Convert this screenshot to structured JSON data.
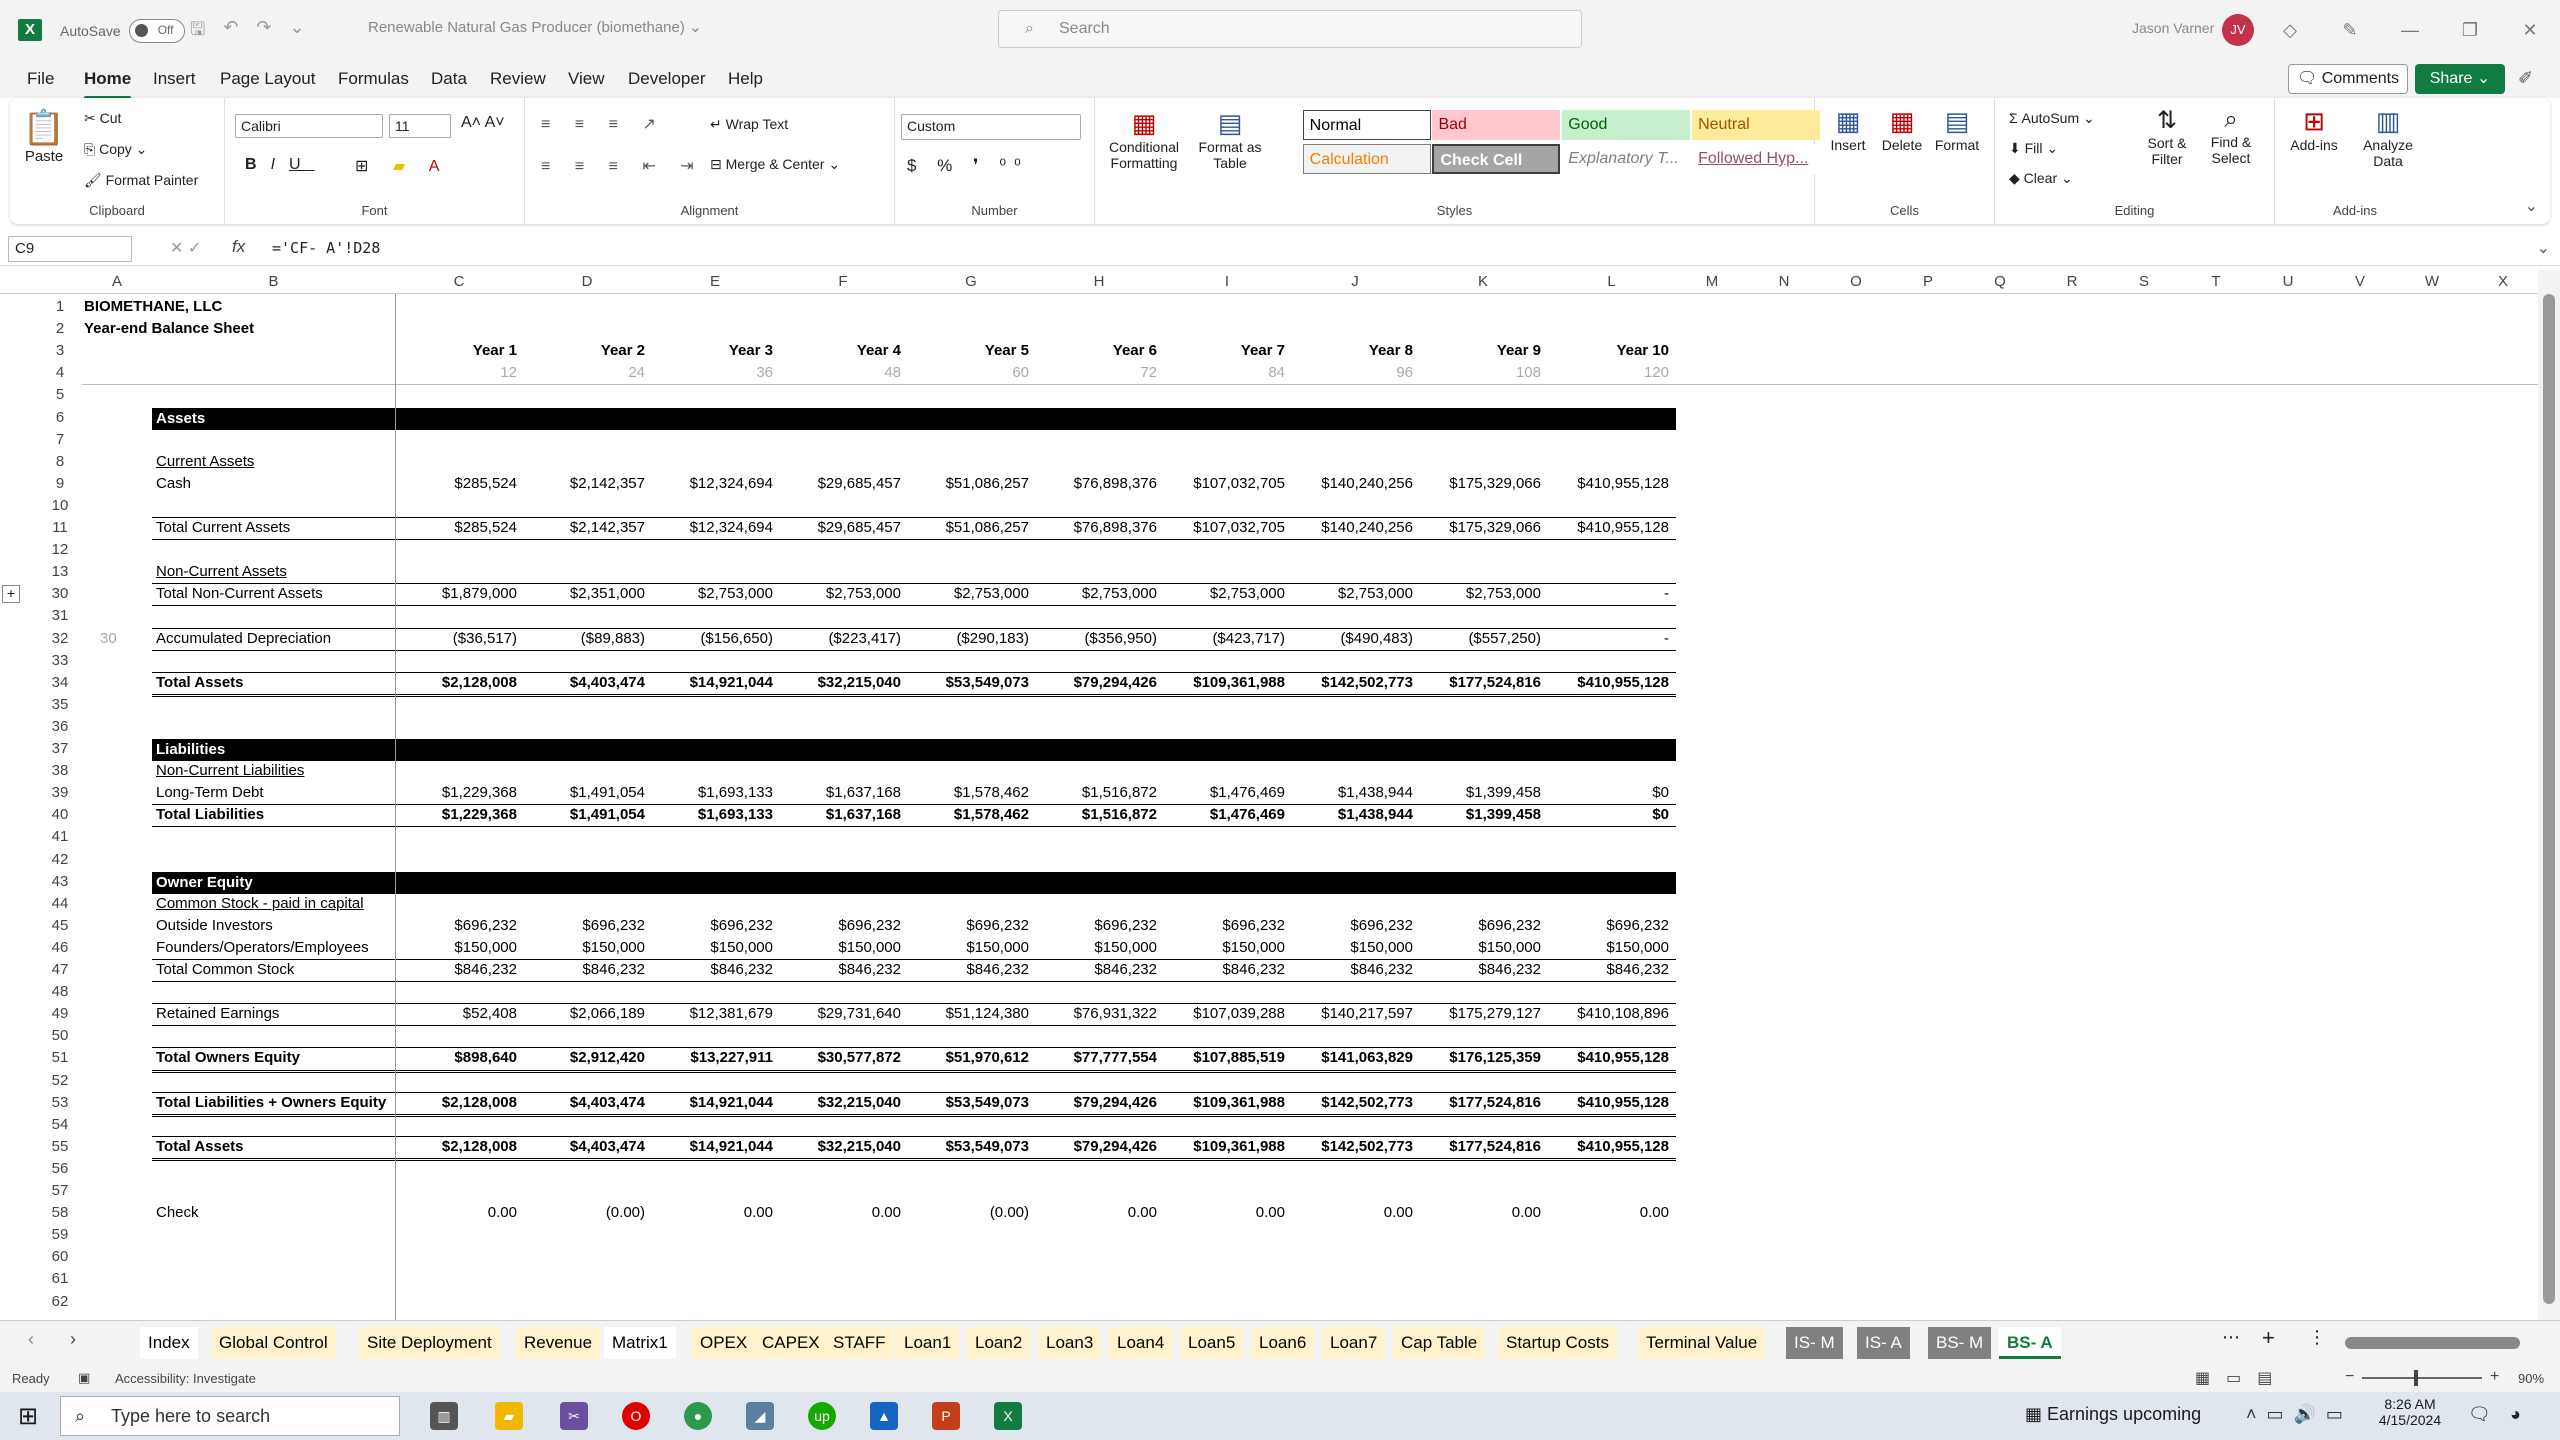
{
  "app": {
    "autosave_label": "AutoSave",
    "autosave_state": "Off",
    "doc_title": "Renewable Natural Gas Producer (biomethane)",
    "search_placeholder": "Search",
    "user_name": "Jason Varner",
    "user_initials": "JV"
  },
  "menu": [
    "File",
    "Home",
    "Insert",
    "Page Layout",
    "Formulas",
    "Data",
    "Review",
    "View",
    "Developer",
    "Help"
  ],
  "menu_active": "Home",
  "actions": {
    "comments": "Comments",
    "share": "Share"
  },
  "ribbon": {
    "clipboard": {
      "label": "Clipboard",
      "paste": "Paste",
      "cut": "Cut",
      "copy": "Copy",
      "format_painter": "Format Painter"
    },
    "font": {
      "label": "Font",
      "name": "Calibri",
      "size": "11"
    },
    "alignment": {
      "label": "Alignment",
      "wrap": "Wrap Text",
      "merge": "Merge & Center"
    },
    "number": {
      "label": "Number",
      "format": "Custom"
    },
    "styles": {
      "label": "Styles",
      "conditional": "Conditional Formatting",
      "format_table": "Format as Table",
      "cells": [
        {
          "text": "Normal",
          "bg": "#ffffff",
          "fg": "#000000"
        },
        {
          "text": "Bad",
          "bg": "#ffc7ce",
          "fg": "#9c0006"
        },
        {
          "text": "Good",
          "bg": "#c6efce",
          "fg": "#006100"
        },
        {
          "text": "Neutral",
          "bg": "#ffeb9c",
          "fg": "#9c5700"
        },
        {
          "text": "Calculation",
          "bg": "#f2f2f2",
          "fg": "#fa7d00"
        },
        {
          "text": "Check Cell",
          "bg": "#a5a5a5",
          "fg": "#ffffff"
        },
        {
          "text": "Explanatory T...",
          "bg": "#ffffff",
          "fg": "#7f7f7f"
        },
        {
          "text": "Followed Hyp...",
          "bg": "#ffffff",
          "fg": "#954f72"
        }
      ]
    },
    "cells": {
      "label": "Cells",
      "insert": "Insert",
      "delete": "Delete",
      "format": "Format"
    },
    "editing": {
      "label": "Editing",
      "autosum": "AutoSum",
      "fill": "Fill",
      "clear": "Clear",
      "sort": "Sort & Filter",
      "find": "Find & Select"
    },
    "addins": {
      "label": "Add-ins",
      "addins": "Add-ins",
      "analyze": "Analyze Data"
    }
  },
  "formula_bar": {
    "cell_ref": "C9",
    "formula": "='CF- A'!D28"
  },
  "columns": [
    "A",
    "B",
    "C",
    "D",
    "E",
    "F",
    "G",
    "H",
    "I",
    "J",
    "K",
    "L",
    "M",
    "N",
    "O",
    "P",
    "Q",
    "R",
    "S",
    "T",
    "U",
    "V",
    "W",
    "X"
  ],
  "sheet": {
    "company": "BIOMETHANE, LLC",
    "title": "Year-end Balance Sheet",
    "years": [
      "Year 1",
      "Year 2",
      "Year 3",
      "Year 4",
      "Year 5",
      "Year 6",
      "Year 7",
      "Year 8",
      "Year 9",
      "Year 10"
    ],
    "months": [
      "12",
      "24",
      "36",
      "48",
      "60",
      "72",
      "84",
      "96",
      "108",
      "120"
    ],
    "a32": "30",
    "rows": [
      {
        "r": "6",
        "section": "Assets"
      },
      {
        "r": "8",
        "label": "Current Assets",
        "ul": true
      },
      {
        "r": "9",
        "label": " Cash",
        "vals": [
          "$285,524",
          "$2,142,357",
          "$12,324,694",
          "$29,685,457",
          "$51,086,257",
          "$76,898,376",
          "$107,032,705",
          "$140,240,256",
          "$175,329,066",
          "$410,955,128"
        ]
      },
      {
        "r": "11",
        "label": "Total Current Assets",
        "vals": [
          "$285,524",
          "$2,142,357",
          "$12,324,694",
          "$29,685,457",
          "$51,086,257",
          "$76,898,376",
          "$107,032,705",
          "$140,240,256",
          "$175,329,066",
          "$410,955,128"
        ]
      },
      {
        "r": "13",
        "label": "Non-Current Assets",
        "ul": true
      },
      {
        "r": "30",
        "label": "Total Non-Current Assets",
        "vals": [
          "$1,879,000",
          "$2,351,000",
          "$2,753,000",
          "$2,753,000",
          "$2,753,000",
          "$2,753,000",
          "$2,753,000",
          "$2,753,000",
          "$2,753,000",
          "-"
        ]
      },
      {
        "r": "32",
        "label": "Accumulated Depreciation",
        "vals": [
          "($36,517)",
          "($89,883)",
          "($156,650)",
          "($223,417)",
          "($290,183)",
          "($356,950)",
          "($423,717)",
          "($490,483)",
          "($557,250)",
          "-"
        ]
      },
      {
        "r": "34",
        "label": "Total Assets",
        "bold": true,
        "vals": [
          "$2,128,008",
          "$4,403,474",
          "$14,921,044",
          "$32,215,040",
          "$53,549,073",
          "$79,294,426",
          "$109,361,988",
          "$142,502,773",
          "$177,524,816",
          "$410,955,128"
        ]
      },
      {
        "r": "37",
        "section": "Liabilities"
      },
      {
        "r": "38",
        "label": "Non-Current Liabilities",
        "ul": true
      },
      {
        "r": "39",
        "label": "Long-Term Debt",
        "vals": [
          "$1,229,368",
          "$1,491,054",
          "$1,693,133",
          "$1,637,168",
          "$1,578,462",
          "$1,516,872",
          "$1,476,469",
          "$1,438,944",
          "$1,399,458",
          "$0"
        ]
      },
      {
        "r": "40",
        "label": "Total Liabilities",
        "bold": true,
        "vals": [
          "$1,229,368",
          "$1,491,054",
          "$1,693,133",
          "$1,637,168",
          "$1,578,462",
          "$1,516,872",
          "$1,476,469",
          "$1,438,944",
          "$1,399,458",
          "$0"
        ]
      },
      {
        "r": "43",
        "section": "Owner Equity"
      },
      {
        "r": "44",
        "label": "Common Stock - paid in capital",
        "ul": true
      },
      {
        "r": "45",
        "label": "Outside Investors",
        "vals": [
          "$696,232",
          "$696,232",
          "$696,232",
          "$696,232",
          "$696,232",
          "$696,232",
          "$696,232",
          "$696,232",
          "$696,232",
          "$696,232"
        ]
      },
      {
        "r": "46",
        "label": "Founders/Operators/Employees",
        "vals": [
          "$150,000",
          "$150,000",
          "$150,000",
          "$150,000",
          "$150,000",
          "$150,000",
          "$150,000",
          "$150,000",
          "$150,000",
          "$150,000"
        ]
      },
      {
        "r": "47",
        "label": "Total Common Stock",
        "vals": [
          "$846,232",
          "$846,232",
          "$846,232",
          "$846,232",
          "$846,232",
          "$846,232",
          "$846,232",
          "$846,232",
          "$846,232",
          "$846,232"
        ]
      },
      {
        "r": "49",
        "label": "Retained Earnings",
        "vals": [
          "$52,408",
          "$2,066,189",
          "$12,381,679",
          "$29,731,640",
          "$51,124,380",
          "$76,931,322",
          "$107,039,288",
          "$140,217,597",
          "$175,279,127",
          "$410,108,896"
        ]
      },
      {
        "r": "51",
        "label": "Total Owners Equity",
        "bold": true,
        "vals": [
          "$898,640",
          "$2,912,420",
          "$13,227,911",
          "$30,577,872",
          "$51,970,612",
          "$77,777,554",
          "$107,885,519",
          "$141,063,829",
          "$176,125,359",
          "$410,955,128"
        ]
      },
      {
        "r": "53",
        "label": "Total Liabilities + Owners Equity",
        "bold": true,
        "vals": [
          "$2,128,008",
          "$4,403,474",
          "$14,921,044",
          "$32,215,040",
          "$53,549,073",
          "$79,294,426",
          "$109,361,988",
          "$142,502,773",
          "$177,524,816",
          "$410,955,128"
        ]
      },
      {
        "r": "55",
        "label": "Total Assets",
        "bold": true,
        "vals": [
          "$2,128,008",
          "$4,403,474",
          "$14,921,044",
          "$32,215,040",
          "$53,549,073",
          "$79,294,426",
          "$109,361,988",
          "$142,502,773",
          "$177,524,816",
          "$410,955,128"
        ]
      },
      {
        "r": "58",
        "label": "Check",
        "vals": [
          "0.00",
          "(0.00)",
          "0.00",
          "0.00",
          "(0.00)",
          "0.00",
          "0.00",
          "0.00",
          "0.00",
          "0.00"
        ]
      }
    ],
    "row_numbers": [
      "1",
      "2",
      "3",
      "4",
      "5",
      "6",
      "7",
      "8",
      "9",
      "10",
      "11",
      "12",
      "13",
      "30",
      "31",
      "32",
      "33",
      "34",
      "35",
      "36",
      "37",
      "38",
      "39",
      "40",
      "41",
      "42",
      "43",
      "44",
      "45",
      "46",
      "47",
      "48",
      "49",
      "50",
      "51",
      "52",
      "53",
      "54",
      "55",
      "56",
      "57",
      "58",
      "59",
      "60",
      "61",
      "62"
    ]
  },
  "tabs": [
    {
      "name": "Index",
      "bg": "#ffffff",
      "fg": "#000"
    },
    {
      "name": "Global Control",
      "bg": "#fff2cc",
      "fg": "#000"
    },
    {
      "name": "Site Deployment",
      "bg": "#fff2cc",
      "fg": "#000"
    },
    {
      "name": "Revenue",
      "bg": "#fff2cc",
      "fg": "#000"
    },
    {
      "name": "Matrix1",
      "bg": "#ffffff",
      "fg": "#000"
    },
    {
      "name": "OPEX",
      "bg": "#fff2cc",
      "fg": "#000"
    },
    {
      "name": "CAPEX",
      "bg": "#fff2cc",
      "fg": "#000"
    },
    {
      "name": "STAFF",
      "bg": "#fff2cc",
      "fg": "#000"
    },
    {
      "name": "Loan1",
      "bg": "#fff2cc",
      "fg": "#000"
    },
    {
      "name": "Loan2",
      "bg": "#fff2cc",
      "fg": "#000"
    },
    {
      "name": "Loan3",
      "bg": "#fff2cc",
      "fg": "#000"
    },
    {
      "name": "Loan4",
      "bg": "#fff2cc",
      "fg": "#000"
    },
    {
      "name": "Loan5",
      "bg": "#fff2cc",
      "fg": "#000"
    },
    {
      "name": "Loan6",
      "bg": "#fff2cc",
      "fg": "#000"
    },
    {
      "name": "Loan7",
      "bg": "#fff2cc",
      "fg": "#000"
    },
    {
      "name": "Cap Table",
      "bg": "#fff2cc",
      "fg": "#000"
    },
    {
      "name": "Startup Costs",
      "bg": "#fff2cc",
      "fg": "#000"
    },
    {
      "name": "Terminal Value",
      "bg": "#fff2cc",
      "fg": "#000"
    },
    {
      "name": "IS- M",
      "bg": "#808080",
      "fg": "#fff"
    },
    {
      "name": "IS- A",
      "bg": "#808080",
      "fg": "#fff"
    },
    {
      "name": "BS- M",
      "bg": "#808080",
      "fg": "#fff"
    },
    {
      "name": "BS- A",
      "bg": "#ffffff",
      "fg": "#107c41"
    }
  ],
  "status": {
    "ready": "Ready",
    "accessibility": "Accessibility: Investigate",
    "zoom": "90%"
  },
  "taskbar": {
    "search": "Type here to search",
    "news": "Earnings upcoming",
    "time": "8:26 AM",
    "date": "4/15/2024"
  }
}
